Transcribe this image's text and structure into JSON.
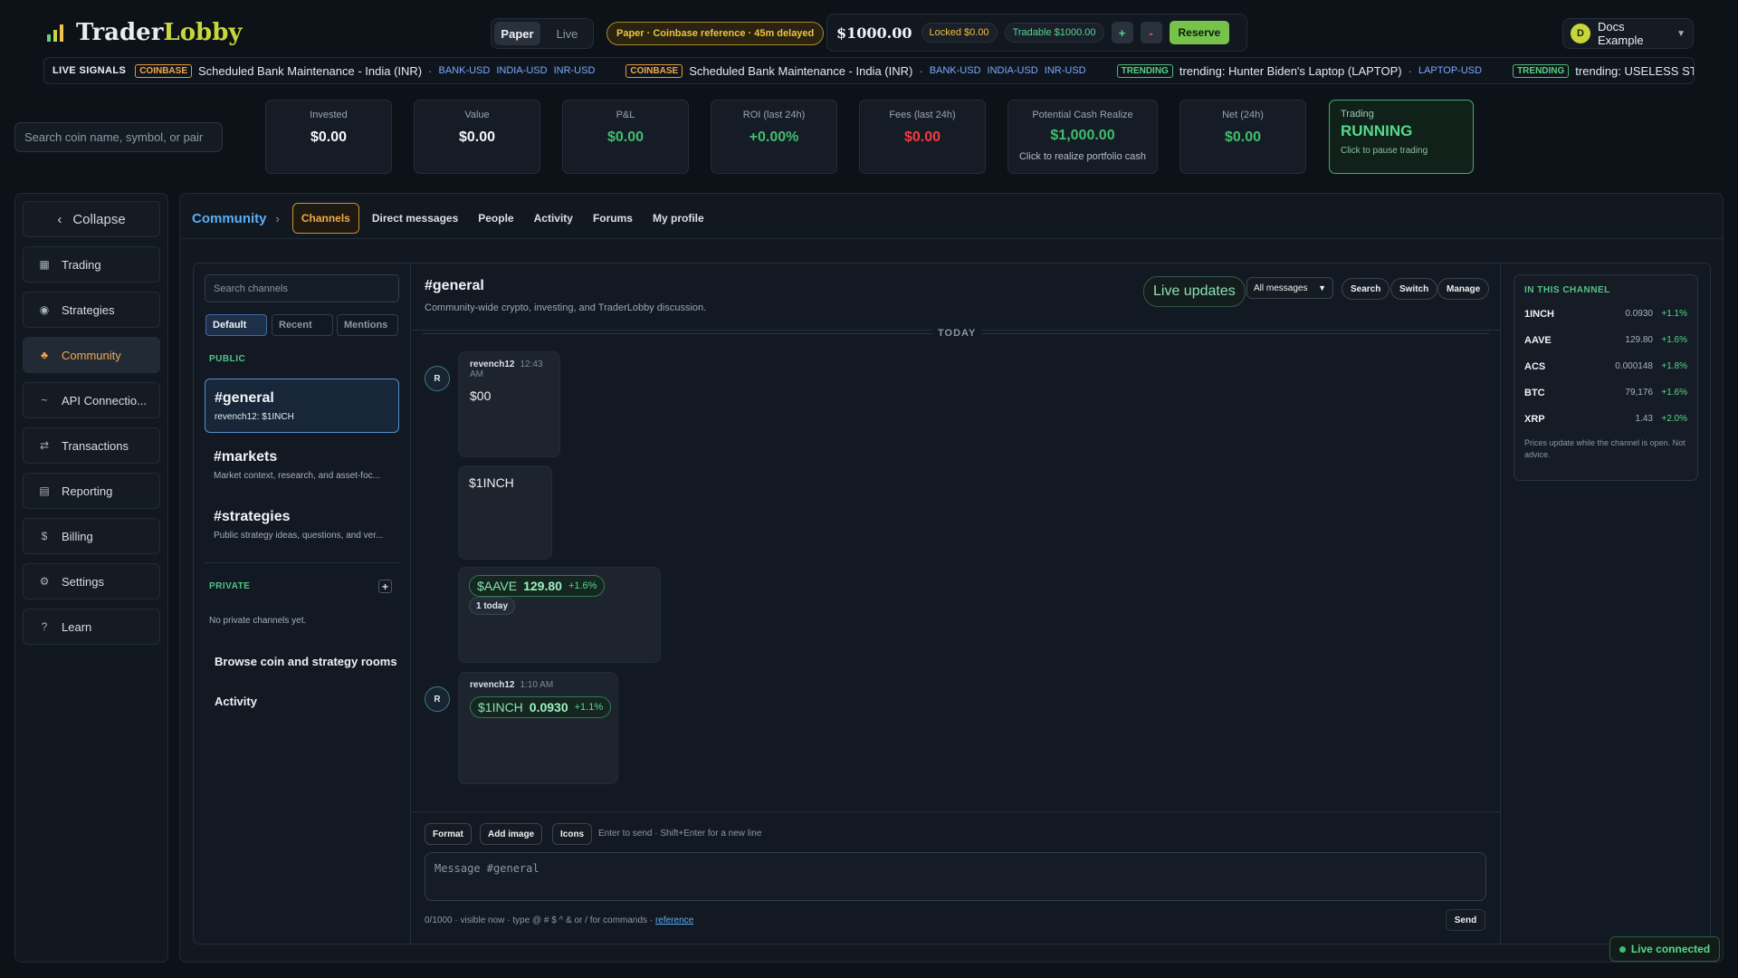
{
  "brand": {
    "name_a": "Trader",
    "name_b": "Lobby"
  },
  "mode": {
    "paper": "Paper",
    "live": "Live"
  },
  "paper_notice": "Paper · Coinbase reference · 45m delayed",
  "balance": {
    "amount": "$1000.00",
    "locked": "Locked $0.00",
    "tradable": "Tradable $1000.00",
    "plus": "+",
    "minus": "-",
    "reserve": "Reserve"
  },
  "user": {
    "initial": "D",
    "name": "Docs Example"
  },
  "ticker": {
    "label": "LIVE SIGNALS",
    "items": [
      {
        "badge": "COINBASE",
        "text": "Scheduled Bank Maintenance - India (INR)",
        "symbols": [
          "BANK-USD",
          "INDIA-USD",
          "INR-USD"
        ]
      },
      {
        "badge": "COINBASE",
        "text": "Scheduled Bank Maintenance - India (INR)",
        "symbols": [
          "BANK-USD",
          "INDIA-USD",
          "INR-USD"
        ]
      },
      {
        "badge": "TRENDING",
        "text": "trending: Hunter Biden's Laptop (LAPTOP)",
        "symbols": [
          "LAPTOP-USD"
        ]
      },
      {
        "badge": "TRENDING",
        "text": "trending: USELESS STONK (STONK",
        "symbols": []
      }
    ]
  },
  "search": {
    "placeholder": "Search coin name, symbol, or pair"
  },
  "stats": [
    {
      "label": "Invested",
      "value": "$0.00"
    },
    {
      "label": "Value",
      "value": "$0.00"
    },
    {
      "label": "P&L",
      "value": "$0.00"
    },
    {
      "label": "ROI (last 24h)",
      "value": "+0.00%"
    },
    {
      "label": "Fees (last 24h)",
      "value": "$0.00"
    },
    {
      "label": "Potential Cash Realize",
      "value": "$1,000.00",
      "sub": "Click to realize portfolio cash"
    },
    {
      "label": "Net (24h)",
      "value": "$0.00"
    }
  ],
  "trading": {
    "label": "Trading",
    "state": "RUNNING",
    "hint": "Click to pause trading"
  },
  "sidebar": {
    "collapse": "Collapse",
    "items": [
      {
        "label": "Trading",
        "icon": "grid-icon"
      },
      {
        "label": "Strategies",
        "icon": "target-icon"
      },
      {
        "label": "Community",
        "icon": "people-icon"
      },
      {
        "label": "API Connectio...",
        "icon": "api-icon"
      },
      {
        "label": "Transactions",
        "icon": "swap-icon"
      },
      {
        "label": "Reporting",
        "icon": "report-icon"
      },
      {
        "label": "Billing",
        "icon": "dollar-icon"
      },
      {
        "label": "Settings",
        "icon": "gear-icon"
      },
      {
        "label": "Learn",
        "icon": "question-icon"
      }
    ]
  },
  "community": {
    "crumb": "Community",
    "tabs": [
      "Channels",
      "Direct messages",
      "People",
      "Activity",
      "Forums",
      "My profile"
    ],
    "channel_search": "Search channels",
    "filters": [
      "Default",
      "Recent",
      "Mentions"
    ],
    "public_label": "PUBLIC",
    "channels": [
      {
        "name": "#general",
        "sub": "revench12: $1INCH"
      },
      {
        "name": "#markets",
        "sub": "Market context, research, and asset-foc..."
      },
      {
        "name": "#strategies",
        "sub": "Public strategy ideas, questions, and ver..."
      }
    ],
    "private_label": "PRIVATE",
    "private_plus": "+",
    "no_private": "No private channels yet.",
    "browse": "Browse coin and strategy rooms",
    "activity": "Activity"
  },
  "channel": {
    "title": "#general",
    "desc": "Community-wide crypto, investing, and TraderLobby discussion.",
    "live_updates": "Live updates",
    "filter": "All messages",
    "buttons": [
      "Search",
      "Switch",
      "Manage"
    ],
    "today": "TODAY"
  },
  "messages": {
    "m1": {
      "avatar": "R",
      "user": "revench12",
      "time": "12:43 AM",
      "text": "$00"
    },
    "m2": {
      "text": "$1INCH"
    },
    "m3": {
      "token": "$AAVE",
      "price": "129.80",
      "change": "+1.6%",
      "today": "1 today"
    },
    "m4": {
      "avatar": "R",
      "user": "revench12",
      "time": "1:10 AM",
      "token": "$1INCH",
      "price": "0.0930",
      "change": "+1.1%"
    }
  },
  "composer": {
    "buttons": [
      "Format",
      "Add image",
      "Icons"
    ],
    "hint": "Enter to send · Shift+Enter for a new line",
    "placeholder": "Message #general",
    "footer": "0/1000 · visible now · type @ # $ ^ & or / for commands ·",
    "footer_link": "reference",
    "send": "Send"
  },
  "in_channel": {
    "title": "IN THIS CHANNEL",
    "coins": [
      {
        "sym": "1INCH",
        "price": "0.0930",
        "change": "+1.1%"
      },
      {
        "sym": "AAVE",
        "price": "129.80",
        "change": "+1.6%"
      },
      {
        "sym": "ACS",
        "price": "0.000148",
        "change": "+1.8%"
      },
      {
        "sym": "BTC",
        "price": "79,176",
        "change": "+1.6%"
      },
      {
        "sym": "XRP",
        "price": "1.43",
        "change": "+2.0%"
      }
    ],
    "note": "Prices update while the channel is open. Not advice."
  },
  "status": {
    "live": "Live connected"
  },
  "colors": {
    "accent": "#f0a94c",
    "green": "#3fbf70",
    "red": "#ef3e3e",
    "link": "#5aaef6"
  }
}
